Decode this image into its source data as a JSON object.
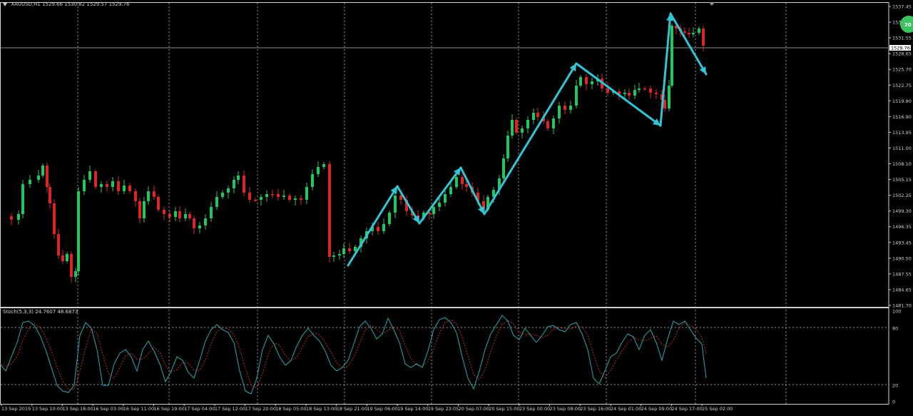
{
  "symbol": {
    "title": "XAUUSD,H1",
    "ohlc": "1529.66 1530.82 1529.57 1529.76"
  },
  "indicator": {
    "label": "Stoch(5,3,3) 24.7607 48.6873",
    "levels": [
      "100",
      "80",
      "20",
      "0"
    ]
  },
  "current_price": "1529.76",
  "badge": "20",
  "price_labels": [
    "1537.45",
    "1534.",
    "1531.55",
    "1528.65",
    "1525.70",
    "1522.75",
    "1519.80",
    "1516.90",
    "1513.95",
    "1511.00",
    "1508.10",
    "1505.15",
    "1502.25",
    "1499.30",
    "1496.35",
    "1493.45",
    "1490.50",
    "1487.55",
    "1484.65",
    "1481.70"
  ],
  "time_labels": [
    "13 Sep 2019",
    "13 Sep 10:00",
    "13 Sep 18:00",
    "16 Sep 03:00",
    "16 Sep 11:00",
    "16 Sep 19:00",
    "17 Sep 04:00",
    "17 Sep 12:00",
    "17 Sep 20:00",
    "18 Sep 05:00",
    "18 Sep 13:00",
    "18 Sep 21:00",
    "19 Sep 06:00",
    "19 Sep 14:00",
    "19 Sep 23:05",
    "20 Sep 07:00",
    "20 Sep 15:00",
    "23 Sep 00:00",
    "23 Sep 08:00",
    "23 Sep 16:00",
    "24 Sep 01:00",
    "24 Sep 09:00",
    "24 Sep 17:00",
    "25 Sep 02:00"
  ],
  "colors": {
    "up": "#22c55e",
    "down": "#dc2626",
    "arrow": "#33c4d6",
    "grid": "#9a9a9a",
    "stoch_main": "#2aa9b0",
    "stoch_signal": "#c0302a"
  }
}
